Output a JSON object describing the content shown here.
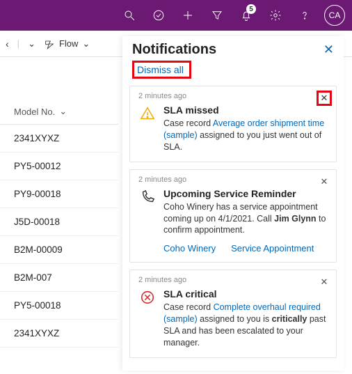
{
  "topbar": {
    "badge_count": "5",
    "avatar_initials": "CA"
  },
  "cmdbar": {
    "flow_label": "Flow"
  },
  "table": {
    "header": "Model No.",
    "rows": [
      "2341XYXZ",
      "PY5-00012",
      "PY9-00018",
      "J5D-00018",
      "B2M-00009",
      "B2M-007",
      "PY5-00018",
      "2341XYXZ"
    ]
  },
  "panel": {
    "title": "Notifications",
    "dismiss_all": "Dismiss all"
  },
  "cards": [
    {
      "time": "2 minutes ago",
      "title": "SLA missed",
      "pre": "Case record ",
      "link": "Average order shipment time (sample)",
      "post": " assigned to you just went out of SLA."
    },
    {
      "time": "2 minutes ago",
      "title": "Upcoming Service Reminder",
      "line1a": "Coho Winery has a service appointment coming up on 4/1/2021. Call ",
      "line1b": "Jim Glynn",
      "line1c": " to confirm appointment.",
      "action1": "Coho Winery",
      "action2": "Service Appointment"
    },
    {
      "time": "2 minutes ago",
      "title": "SLA critical",
      "pre": "Case record ",
      "link": "Complete overhaul required (sample)",
      "mid": " assigned to you is ",
      "bold": "critically",
      "post": " past SLA and has been escalated to your manager."
    }
  ]
}
